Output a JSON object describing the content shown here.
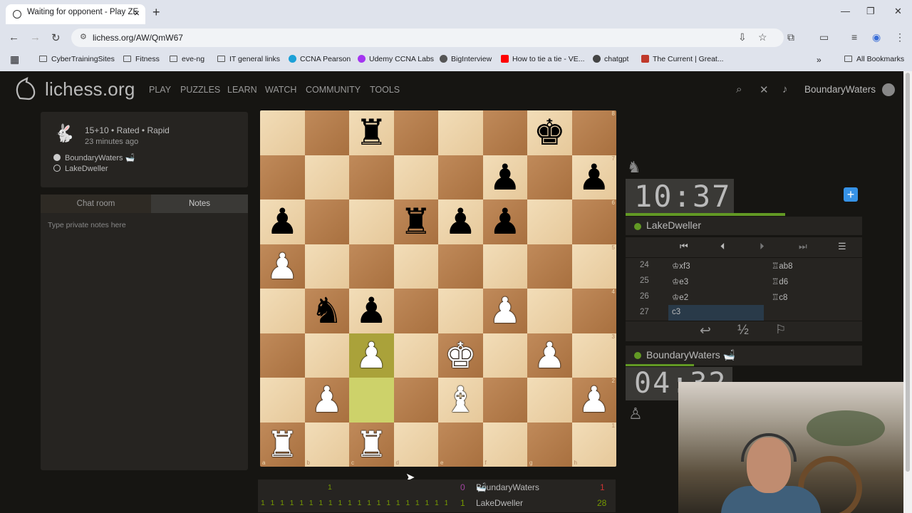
{
  "browser": {
    "tab_title": "Waiting for opponent - Play ZE",
    "url": "lichess.org/AW/QmW67",
    "bookmarks": [
      "CyberTrainingSites",
      "Fitness",
      "eve-ng",
      "IT general links",
      "CCNA Pearson",
      "Udemy CCNA Labs",
      "BigInterview",
      "How to tie a tie - VE...",
      "chatgpt",
      "The Current | Great..."
    ],
    "all_bookmarks": "All Bookmarks"
  },
  "site": {
    "logo": "lichess.org",
    "nav": [
      "PLAY",
      "PUZZLES",
      "LEARN",
      "WATCH",
      "COMMUNITY",
      "TOOLS"
    ],
    "username": "BoundaryWaters"
  },
  "game": {
    "meta": "15+10 • Rated • Rapid",
    "time_ago": "23 minutes ago",
    "white_player": "BoundaryWaters",
    "black_player": "LakeDweller",
    "player_flag": "🛁"
  },
  "chat": {
    "tab_chat": "Chat room",
    "tab_notes": "Notes",
    "notes_placeholder": "Type private notes here"
  },
  "board": {
    "ranks": [
      [
        "",
        "",
        "♜",
        "",
        "",
        "",
        "♚",
        ""
      ],
      [
        "",
        "",
        "",
        "",
        "",
        "♟",
        "",
        "♟"
      ],
      [
        "♟",
        "",
        "",
        "♜",
        "♟",
        "♟",
        "",
        ""
      ],
      [
        "♙",
        "",
        "",
        "",
        "",
        "",
        "",
        ""
      ],
      [
        "",
        "♞",
        "♟",
        "",
        "",
        "♙",
        "",
        ""
      ],
      [
        "",
        "",
        "♙",
        "",
        "♔",
        "",
        "♙",
        ""
      ],
      [
        "",
        "♙",
        "",
        "",
        "♗",
        "",
        "",
        "♙"
      ],
      [
        "♖",
        "",
        "♖",
        "",
        "",
        "",
        "",
        ""
      ]
    ],
    "highlight": [
      "c3",
      "c2"
    ],
    "files": [
      "a",
      "b",
      "c",
      "d",
      "e",
      "f",
      "g",
      "h"
    ],
    "rank_labels": [
      "8",
      "7",
      "6",
      "5",
      "4",
      "3",
      "2",
      "1"
    ]
  },
  "crosstable": {
    "top_row": "1",
    "bottom_row": "1 1 1 1 1 1 1   1 1 1 1 1 1 1 1 1 1 1 1 1 1",
    "p1": "BoundaryWaters",
    "p1_flag": "🛁",
    "p1_score": "1",
    "p1_left": "0",
    "p2": "LakeDweller",
    "p2_score": "28",
    "p2_left": "1"
  },
  "clocks": {
    "opponent": "10:37",
    "me": "04:32"
  },
  "opponent_name": "LakeDweller",
  "me_name": "BoundaryWaters",
  "moves": [
    {
      "n": "24",
      "w": "♔xf3",
      "b": "♖ab8"
    },
    {
      "n": "25",
      "w": "♔e3",
      "b": "♖d6"
    },
    {
      "n": "26",
      "w": "♔e2",
      "b": "♖c8"
    },
    {
      "n": "27",
      "w": "c3",
      "b": ""
    }
  ],
  "actions": {
    "draw": "½"
  },
  "colors": {
    "accent": "#629924",
    "light": "#f0d9b5",
    "dark": "#b58863",
    "highlight": "#cdd26a",
    "plus": "#3692e7"
  }
}
